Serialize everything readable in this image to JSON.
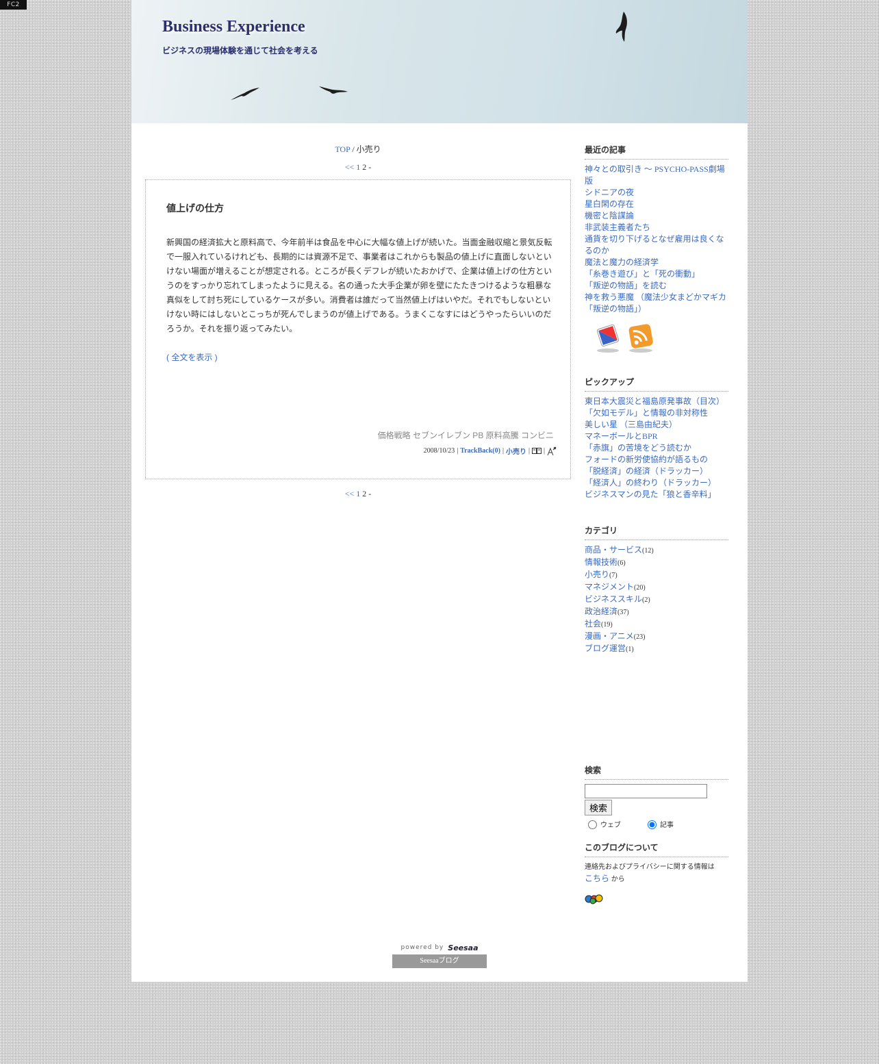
{
  "fc2_badge": "FC2",
  "header": {
    "title": "Business Experience",
    "description": "ビジネスの現場体験を通じて社会を考える"
  },
  "breadcrumb": {
    "top_label": "TOP",
    "separator": "/",
    "current": "小売り"
  },
  "pager": {
    "prev": "<<",
    "page1": "1",
    "page2": "2",
    "suffix": "-"
  },
  "entry": {
    "title": "値上げの仕方",
    "body": "新興国の経済拡大と原料高で、今年前半は食品を中心に大幅な値上げが続いた。当面金融収縮と景気反転で一服入れているけれども、長期的には資源不足で、事業者はこれからも製品の値上げに直面しないといけない場面が増えることが想定される。ところが長くデフレが続いたおかげで、企業は値上げの仕方というのをすっかり忘れてしまったように見える。名の通った大手企業が卵を壁にたたきつけるような粗暴な真似をして討ち死にしているケースが多い。消費者は誰だって当然値上げはいやだ。それでもしないといけない時にはしないとこっちが死んでしまうのが値上げである。うまくこなすにはどうやったらいいのだろうか。それを振り返ってみたい。",
    "more_label": "( 全文を表示 )",
    "tags": "価格戦略 セブンイレブン PB 原料高騰 コンビニ",
    "date": "2008/10/23",
    "trackback": "TrackBack(0)",
    "category": "小売り",
    "separator": "|"
  },
  "sidebar": {
    "recent": {
      "title": "最近の記事",
      "items": [
        "神々との取引き ～ PSYCHO-PASS劇場版",
        "シドニアの夜",
        "星白閑の存在",
        "機密と陰謀論",
        "非武装主義者たち",
        "通貨を切り下げるとなぜ雇用は良くなるのか",
        "魔法と魔力の経済学",
        "「糸巻き遊び」と「死の衝動」",
        "「叛逆の物語」を読む",
        "神を救う悪魔 （魔法少女まどかマギカ「叛逆の物語」）"
      ]
    },
    "pickup": {
      "title": "ピックアップ",
      "items": [
        "東日本大震災と福島原発事故（目次）",
        "「欠如モデル」と情報の非対称性",
        "美しい星 （三島由紀夫）",
        "マネーボールとBPR",
        "「赤旗」の苦境をどう読むか",
        "フォードの新労使協約が語るもの",
        "「脱経済」の経済（ドラッカー）",
        "「経済人」の終わり（ドラッカー）",
        "ビジネスマンの見た「狼と香辛料」"
      ]
    },
    "categories": {
      "title": "カテゴリ",
      "items": [
        {
          "name": "商品・サービス",
          "count": "(12)"
        },
        {
          "name": "情報技術",
          "count": "(6)"
        },
        {
          "name": "小売り",
          "count": "(7)"
        },
        {
          "name": "マネジメント",
          "count": "(20)"
        },
        {
          "name": "ビジネススキル",
          "count": "(2)"
        },
        {
          "name": "政治経済",
          "count": "(37)"
        },
        {
          "name": "社会",
          "count": "(19)"
        },
        {
          "name": "漫画・アニメ",
          "count": "(23)"
        },
        {
          "name": "ブログ運営",
          "count": "(1)"
        }
      ]
    },
    "search": {
      "title": "検索",
      "input_value": "",
      "button": "検索",
      "radio_web": "ウェブ",
      "radio_article": "記事"
    },
    "about": {
      "title": "このブログについて",
      "text": "連絡先およびプライバシーに関する情報は",
      "link": "こちら",
      "suffix": "から"
    }
  },
  "footer": {
    "powered_by": "powered by",
    "brand": "Seesaa",
    "blog_label": "Seesaaブログ"
  },
  "colors": {
    "link": "#3a6ac0",
    "title": "#2b2f6b",
    "background": "#cfcfcf"
  }
}
